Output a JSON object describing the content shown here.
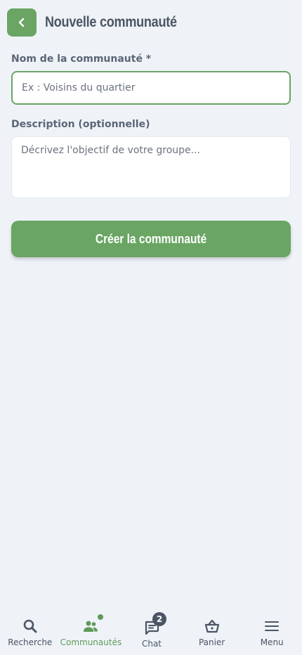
{
  "header": {
    "title": "Nouvelle communauté",
    "back_icon": "chevron-left-icon"
  },
  "form": {
    "name_label": "Nom de la communauté *",
    "name_placeholder": "Ex : Voisins du quartier",
    "name_value": "",
    "description_label": "Description (optionnelle)",
    "description_placeholder": "Décrivez l'objectif de votre groupe...",
    "description_value": "",
    "submit_label": "Créer la communauté"
  },
  "nav": {
    "items": [
      {
        "label": "Recherche",
        "icon": "search-icon"
      },
      {
        "label": "Communautés",
        "icon": "people-icon",
        "active": true
      },
      {
        "label": "Chat",
        "icon": "chat-icon",
        "badge": "2"
      },
      {
        "label": "Panier",
        "icon": "basket-icon"
      },
      {
        "label": "Menu",
        "icon": "menu-icon"
      }
    ]
  },
  "colors": {
    "accent": "#6aa564",
    "background": "#eff3f8",
    "text": "#4b5563"
  }
}
